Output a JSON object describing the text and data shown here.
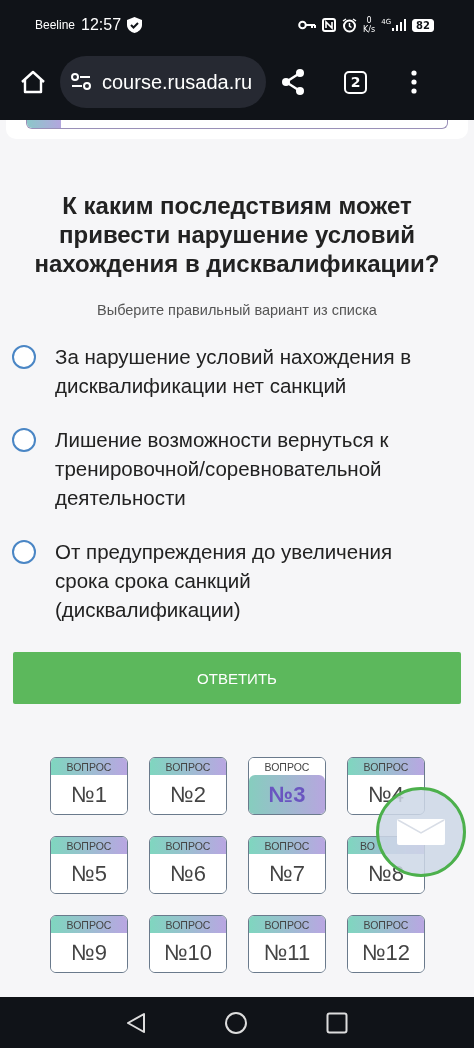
{
  "status_bar": {
    "carrier": "Beeline",
    "time": "12:57",
    "speed_value": "0",
    "speed_unit": "K/s",
    "network": "4G",
    "battery": "82"
  },
  "browser": {
    "url": "course.rusada.ru",
    "tab_count": "2"
  },
  "progress": {
    "level": 0.08
  },
  "question": {
    "title": "К каким последствиям может привести нарушение условий нахождения в дисквалификации?",
    "hint": "Выберите правильный вариант из списка",
    "options": [
      {
        "text": "За нарушение условий нахождения в дисквалификации нет санкций",
        "selected": false
      },
      {
        "text": "Лишение возможности вернуться к тренировочной/соревновательной деятельности",
        "selected": false
      },
      {
        "text": "От предупреждения до увеличения срока срока санкций (дисквалификации)",
        "selected": false
      }
    ],
    "submit": "ОТВЕТИТЬ"
  },
  "questions_nav": [
    {
      "caption": "ВОПРОС",
      "number": "№1",
      "selected": false
    },
    {
      "caption": "ВОПРОС",
      "number": "№2",
      "selected": false
    },
    {
      "caption": "ВОПРОС",
      "number": "№3",
      "selected": true
    },
    {
      "caption": "ВОПРОС",
      "number": "№4",
      "selected": false
    },
    {
      "caption": "ВОПРОС",
      "number": "№5",
      "selected": false
    },
    {
      "caption": "ВОПРОС",
      "number": "№6",
      "selected": false
    },
    {
      "caption": "ВОПРОС",
      "number": "№7",
      "selected": false
    },
    {
      "caption": "ВО",
      "number": "№8",
      "selected": false
    },
    {
      "caption": "ВОПРОС",
      "number": "№9",
      "selected": false
    },
    {
      "caption": "ВОПРОС",
      "number": "№10",
      "selected": false
    },
    {
      "caption": "ВОПРОС",
      "number": "№11",
      "selected": false
    },
    {
      "caption": "ВОПРОС",
      "number": "№12",
      "selected": false
    }
  ]
}
